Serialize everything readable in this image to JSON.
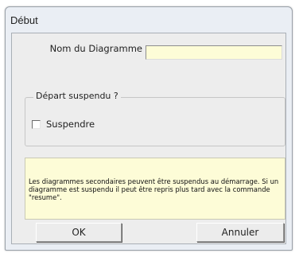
{
  "window": {
    "title": "Début"
  },
  "form": {
    "name_label": "Nom du Diagramme",
    "name_value": "",
    "group_title": "Départ suspendu ?",
    "suspend_label": "Suspendre",
    "suspend_checked": false
  },
  "info": {
    "text": "Les diagrammes secondaires peuvent être suspendus au démarrage. Si un diagramme est suspendu il peut être repris plus tard avec la commande \"resume\"."
  },
  "buttons": {
    "ok_label": "OK",
    "cancel_label": "Annuler"
  },
  "colors": {
    "input_background": "#fdfcd7",
    "dialog_background": "#ededed",
    "window_frame": "#eaeef4"
  }
}
